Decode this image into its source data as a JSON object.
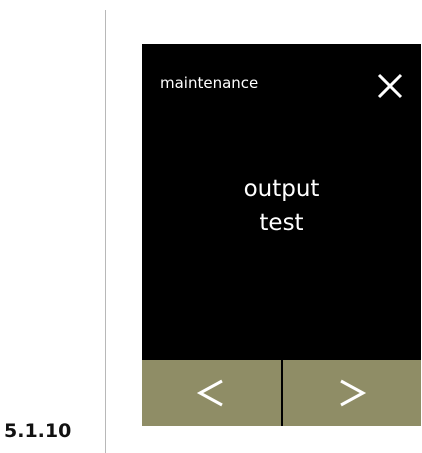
{
  "section_number": "5.1.10",
  "screen": {
    "title": "maintenance",
    "message_line1": "output",
    "message_line2": "test",
    "colors": {
      "background": "#000000",
      "text": "#ffffff",
      "nav_button": "#8f8d66"
    }
  },
  "icons": {
    "close": "close-icon",
    "previous": "chevron-left-icon",
    "next": "chevron-right-icon"
  }
}
